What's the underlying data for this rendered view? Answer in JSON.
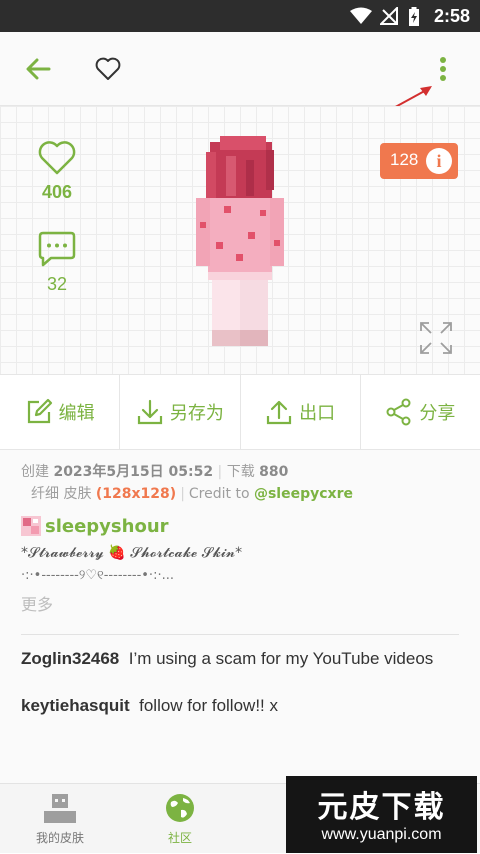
{
  "status_bar": {
    "time": "2:58",
    "icons": [
      "wifi-icon",
      "no-signal-icon",
      "battery-charging-icon"
    ]
  },
  "app_bar": {
    "icons": [
      "back-arrow-icon",
      "heart-outline-icon",
      "more-vert-icon"
    ]
  },
  "preview": {
    "likes": "406",
    "comments": "32",
    "resolution_badge": "128",
    "badge_info": "i"
  },
  "actions": [
    {
      "label": "编辑",
      "icon": "edit-icon"
    },
    {
      "label": "另存为",
      "icon": "download-icon"
    },
    {
      "label": "出口",
      "icon": "upload-icon"
    },
    {
      "label": "分享",
      "icon": "share-icon"
    }
  ],
  "meta": {
    "created_label": "创建",
    "created_value": "2023年5月15日 05:52",
    "sep": "|",
    "downloads_label": "下载",
    "downloads_value": "880",
    "type_text": "纤细 皮肤",
    "dimensions": "(128x128)",
    "credit_label": "Credit to",
    "credit_user": "@sleepycxre"
  },
  "author": {
    "name": "sleepyshour"
  },
  "description": {
    "line1": "*𝓢𝓽𝓻𝓪𝔀𝓫𝓮𝓻𝓻𝔂 🍓 𝓢𝓱𝓸𝓻𝓽𝓬𝓪𝓴𝓮 𝓢𝓴𝓲𝓷*",
    "line2": "·:·•--------୨♡୧--------•·:·...",
    "more": "更多"
  },
  "comments": [
    {
      "user": "Zoglin32468",
      "text": "I’m using a scam for my YouTube videos"
    },
    {
      "user": "keytiehasquit",
      "text": "follow for follow!! x"
    }
  ],
  "tabs": [
    {
      "label": "我的皮肤",
      "icon": "my-skins-icon"
    },
    {
      "label": "社区",
      "icon": "globe-icon"
    }
  ],
  "watermark": {
    "title": "元皮下载",
    "url": "www.yuanpi.com"
  },
  "colors": {
    "accent": "#7cb342",
    "badge": "#f0784e",
    "status_bar": "#2d2d2d"
  }
}
